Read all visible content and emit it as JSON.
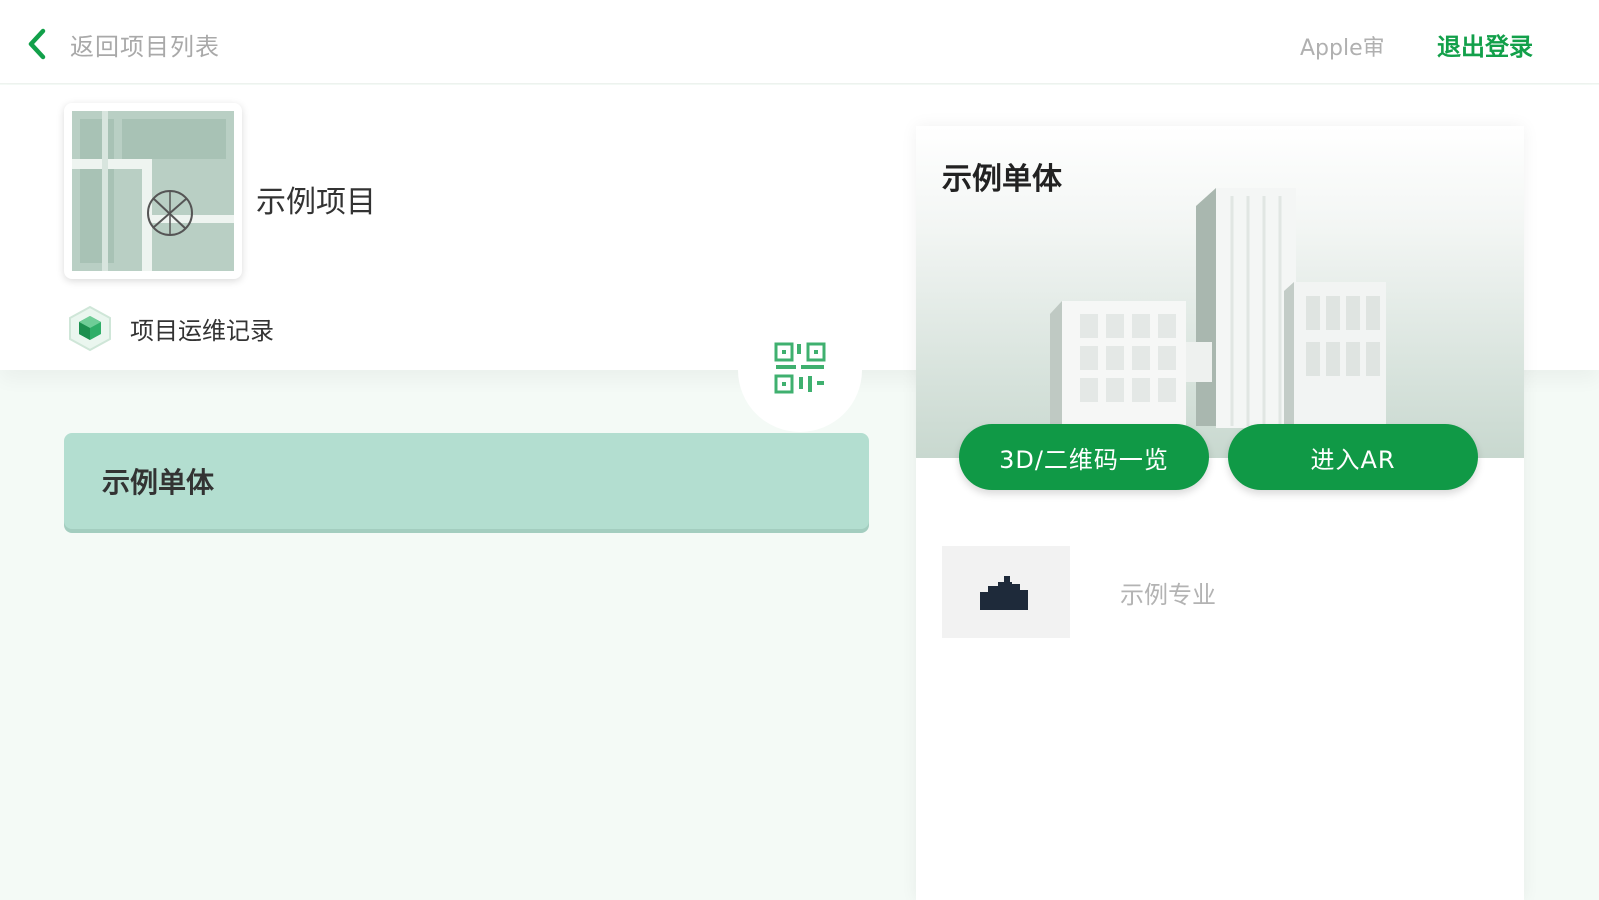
{
  "header": {
    "back_label": "返回项目列表",
    "user_name": "Apple审",
    "logout_label": "退出登录"
  },
  "project": {
    "name": "示例项目",
    "ops_label": "项目运维记录"
  },
  "buildings": [
    {
      "label": "示例单体",
      "selected": true
    }
  ],
  "panel": {
    "title": "示例单体",
    "qr_button_label": "3D/二维码一览",
    "ar_button_label": "进入AR",
    "disciplines": [
      {
        "label": "示例专业"
      }
    ]
  },
  "colors": {
    "accent": "#12a04a",
    "selected_item": "#b3ded0",
    "background": "#f4faf6"
  },
  "icons": {
    "back": "chevron-left-icon",
    "ops": "cube-icon",
    "qr": "qr-code-icon"
  }
}
